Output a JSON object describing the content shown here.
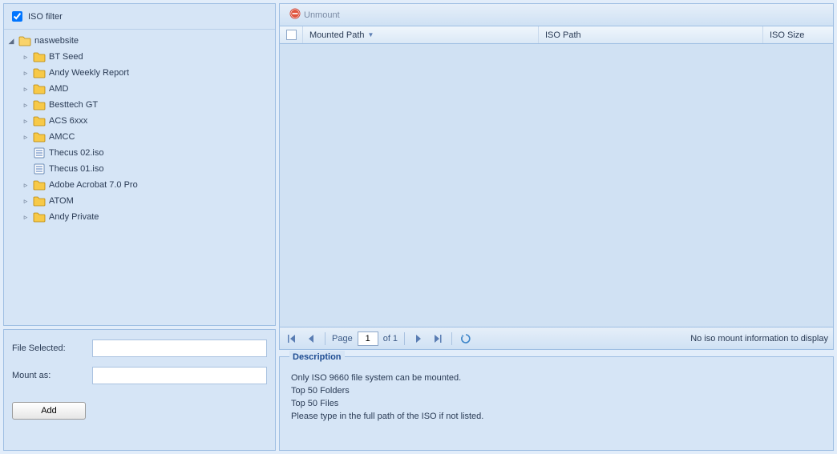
{
  "tree": {
    "filter_label": "ISO filter",
    "root": {
      "label": "naswebsite",
      "expanded": true,
      "children": [
        {
          "type": "folder",
          "label": "BT Seed"
        },
        {
          "type": "folder",
          "label": "Andy Weekly Report"
        },
        {
          "type": "folder",
          "label": "AMD"
        },
        {
          "type": "folder",
          "label": "Besttech GT"
        },
        {
          "type": "folder",
          "label": "ACS 6xxx"
        },
        {
          "type": "folder",
          "label": "AMCC"
        },
        {
          "type": "iso",
          "label": "Thecus 02.iso"
        },
        {
          "type": "iso",
          "label": "Thecus 01.iso"
        },
        {
          "type": "folder",
          "label": "Adobe Acrobat 7.0 Pro"
        },
        {
          "type": "folder",
          "label": "ATOM"
        },
        {
          "type": "folder",
          "label": "Andy Private"
        }
      ]
    }
  },
  "form": {
    "file_selected_label": "File Selected:",
    "file_selected_value": "",
    "mount_as_label": "Mount as:",
    "mount_as_value": "",
    "add_button": "Add"
  },
  "grid": {
    "unmount_label": "Unmount",
    "columns": {
      "mounted_path": "Mounted Path",
      "iso_path": "ISO Path",
      "iso_size": "ISO Size"
    },
    "sort_asc_on": "mounted_path",
    "rows": [],
    "paging": {
      "page_label": "Page",
      "page": "1",
      "of_label": "of 1"
    },
    "empty_text": "No iso mount information to display"
  },
  "description": {
    "title": "Description",
    "line1": "Only ISO 9660 file system can be mounted.",
    "line2": "Top 50 Folders",
    "line3": "Top 50 Files",
    "line4": "Please type in the full path of the ISO if not listed."
  }
}
